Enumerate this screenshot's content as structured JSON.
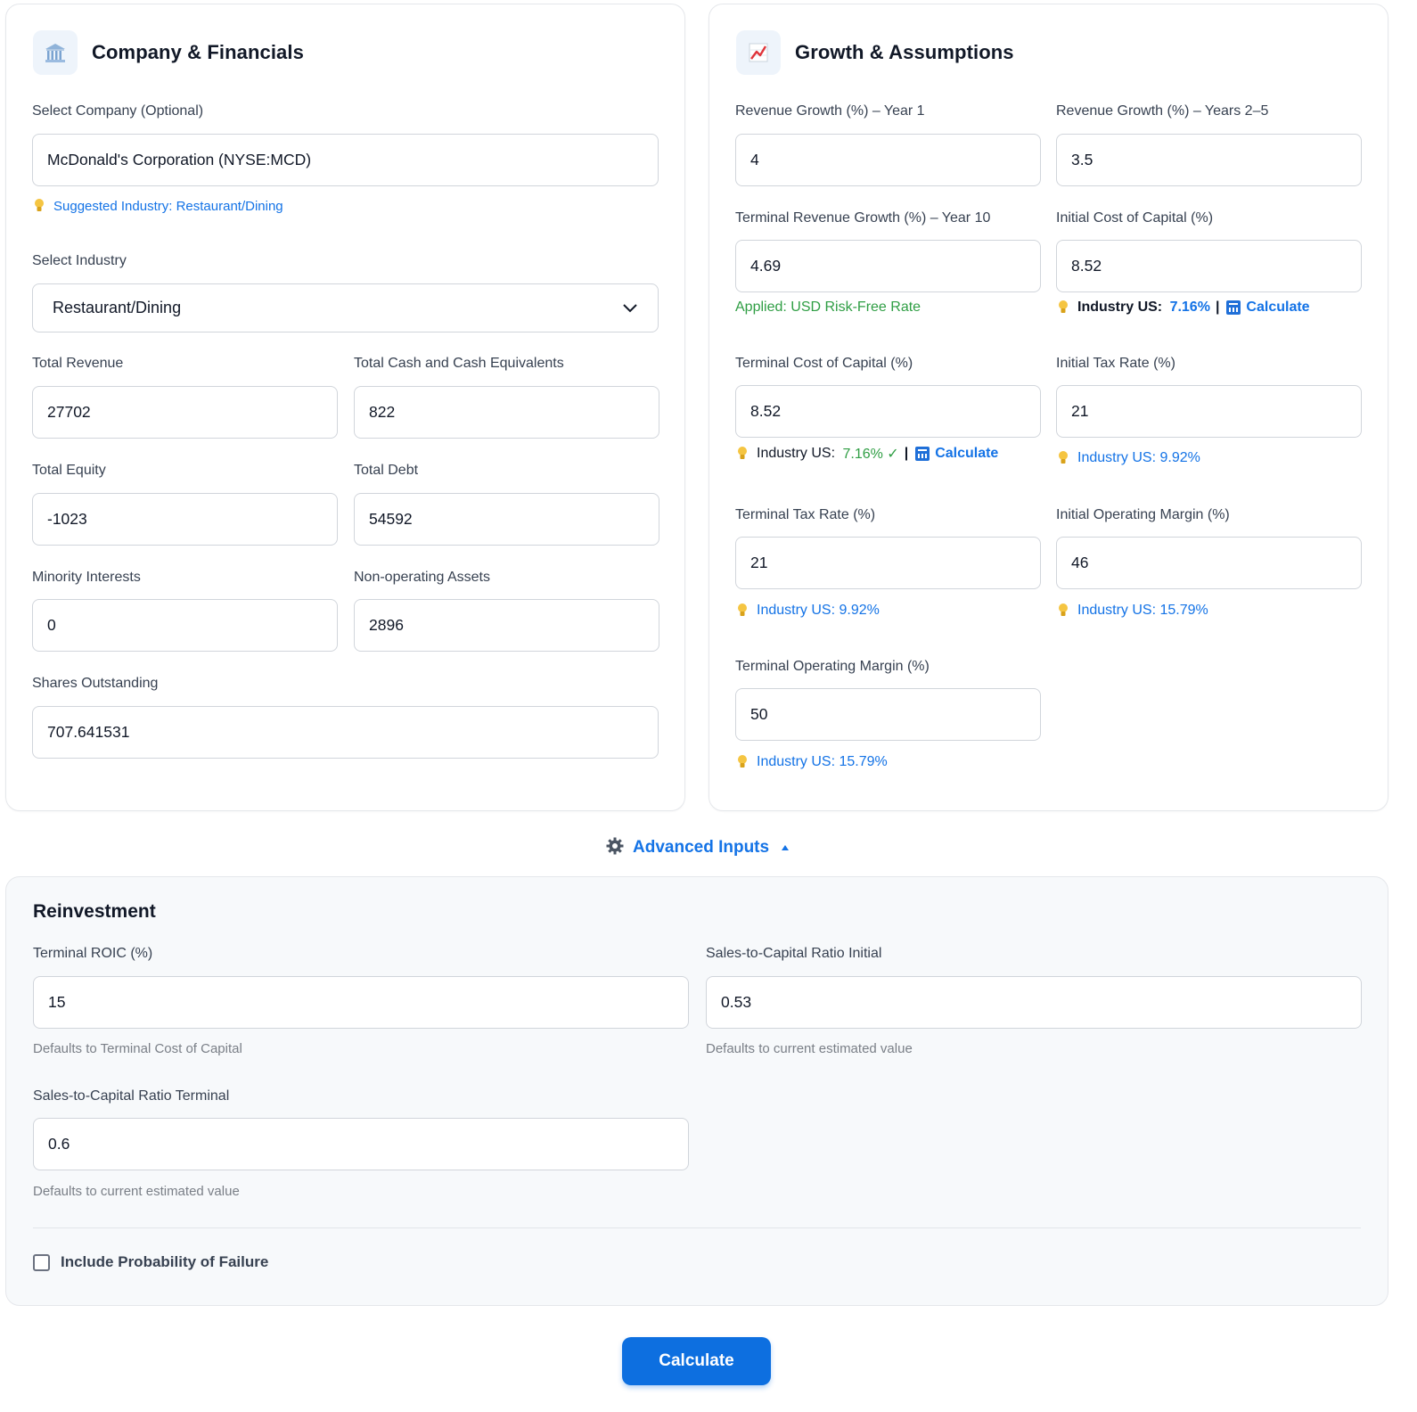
{
  "left_card": {
    "title": "Company & Financials",
    "icon": "bank-building-icon",
    "company_label": "Select Company (Optional)",
    "company_value": "McDonald's Corporation (NYSE:MCD)",
    "suggested_industry": "Suggested Industry: Restaurant/Dining",
    "industry_label": "Select Industry",
    "industry_value": "Restaurant/Dining",
    "total_revenue_label": "Total Revenue",
    "total_revenue_value": "27702",
    "total_cash_label": "Total Cash and Cash Equivalents",
    "total_cash_value": "822",
    "total_equity_label": "Total Equity",
    "total_equity_value": "-1023",
    "total_debt_label": "Total Debt",
    "total_debt_value": "54592",
    "minority_label": "Minority Interests",
    "minority_value": "0",
    "nonop_label": "Non-operating Assets",
    "nonop_value": "2896",
    "shares_label": "Shares Outstanding",
    "shares_value": "707.641531"
  },
  "right_card": {
    "title": "Growth & Assumptions",
    "icon": "chart-increasing-icon",
    "rev_growth_y1_label": "Revenue Growth (%) – Year 1",
    "rev_growth_y1_value": "4",
    "rev_growth_y25_label": "Revenue Growth (%) – Years 2–5",
    "rev_growth_y25_value": "3.5",
    "terminal_growth_label": "Terminal Revenue Growth (%) – Year 10",
    "terminal_growth_value": "4.69",
    "terminal_growth_note": "Applied: USD Risk-Free Rate",
    "initial_coc_label": "Initial Cost of Capital (%)",
    "initial_coc_value": "8.52",
    "initial_coc_hint_prefix": "Industry US: ",
    "initial_coc_hint_value": "7.16%",
    "initial_coc_hint_sep": "|",
    "initial_coc_calc": "Calculate",
    "terminal_coc_label": "Terminal Cost of Capital (%)",
    "terminal_coc_value": "8.52",
    "terminal_coc_hint_prefix": "Industry US: ",
    "terminal_coc_hint_value": "7.16% ✓",
    "terminal_coc_hint_sep": "|",
    "terminal_coc_calc": "Calculate",
    "initial_tax_label": "Initial Tax Rate (%)",
    "initial_tax_value": "21",
    "initial_tax_hint": "Industry US: 9.92%",
    "terminal_tax_label": "Terminal Tax Rate (%)",
    "terminal_tax_value": "21",
    "terminal_tax_hint": "Industry US: 9.92%",
    "initial_margin_label": "Initial Operating Margin (%)",
    "initial_margin_value": "46",
    "initial_margin_hint": "Industry US: 15.79%",
    "terminal_margin_label": "Terminal Operating Margin (%)",
    "terminal_margin_value": "50",
    "terminal_margin_hint": "Industry US: 15.79%"
  },
  "advanced": {
    "toggle_label": "Advanced Inputs",
    "section_title": "Reinvestment",
    "terminal_roic_label": "Terminal ROIC (%)",
    "terminal_roic_value": "15",
    "terminal_roic_note": "Defaults to Terminal Cost of Capital",
    "stc_initial_label": "Sales-to-Capital Ratio Initial",
    "stc_initial_value": "0.53",
    "stc_initial_note": "Defaults to current estimated value",
    "stc_terminal_label": "Sales-to-Capital Ratio Terminal",
    "stc_terminal_value": "0.6",
    "stc_terminal_note": "Defaults to current estimated value",
    "failure_label": "Include Probability of Failure",
    "failure_checked": false
  },
  "calculate_button": "Calculate",
  "colors": {
    "accent": "#1473e6",
    "success": "#2f9e44",
    "button": "#0d6fe0"
  }
}
